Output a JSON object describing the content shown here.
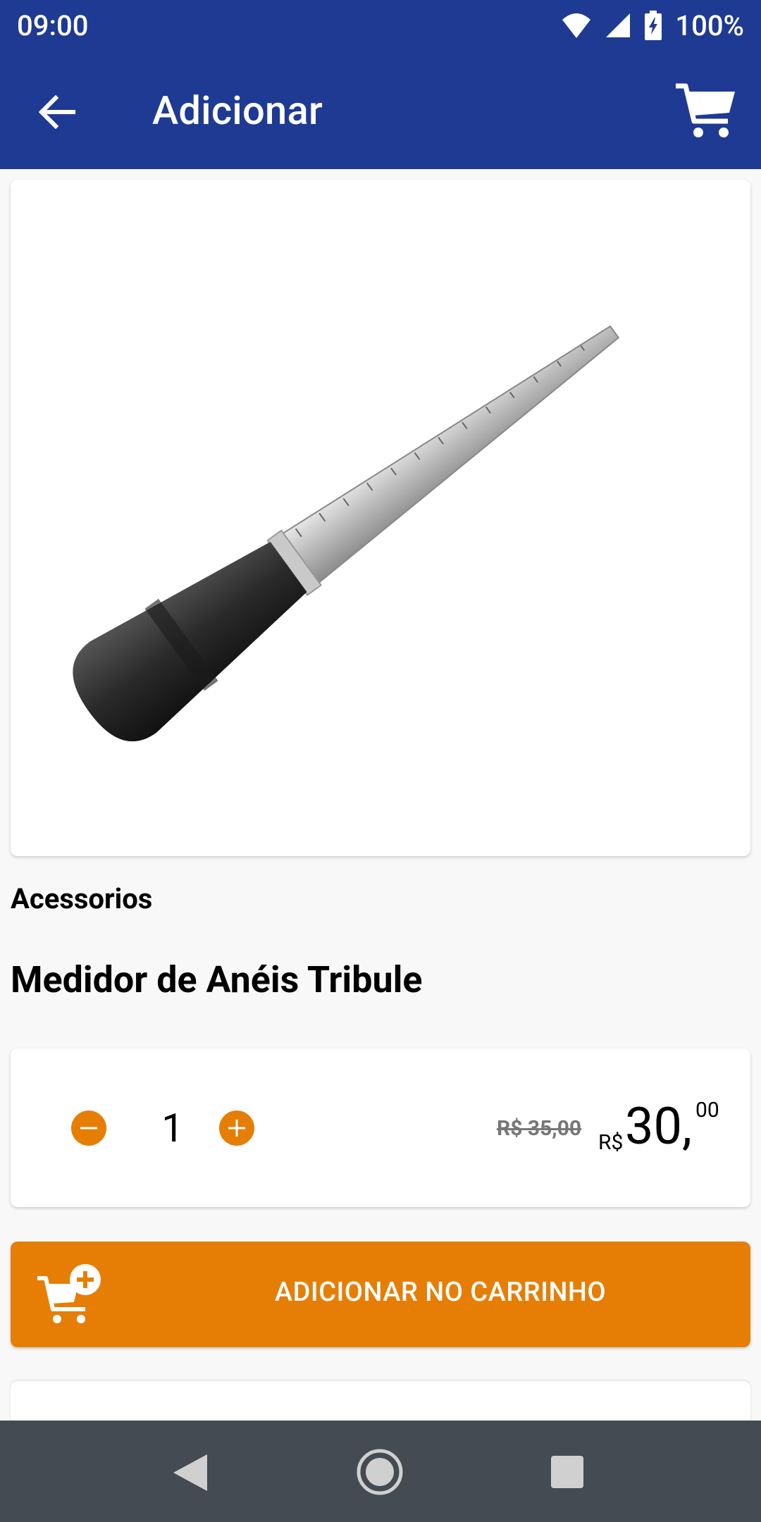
{
  "status_bar": {
    "time": "09:00",
    "battery": "100%",
    "icons": [
      "wifi-icon",
      "signal-icon",
      "battery-charging-icon"
    ]
  },
  "app_bar": {
    "title": "Adicionar",
    "back_icon": "arrow-left-icon",
    "cart_icon": "cart-icon"
  },
  "product": {
    "category": "Acessorios",
    "name": "Medidor de Anéis Tribule",
    "image": "ring-sizer-mandrel"
  },
  "quantity": {
    "value": "1",
    "minus_icon": "minus-circle-icon",
    "plus_icon": "plus-circle-icon"
  },
  "price": {
    "old": "R$ 35,00",
    "currency": "R$",
    "integer": "30,",
    "cents": "00"
  },
  "add_button": {
    "label": "ADICIONAR NO CARRINHO",
    "icon": "cart-add-icon"
  },
  "colors": {
    "primary": "#1f3a93",
    "accent": "#e67e06",
    "nav_bar": "#454b52"
  }
}
